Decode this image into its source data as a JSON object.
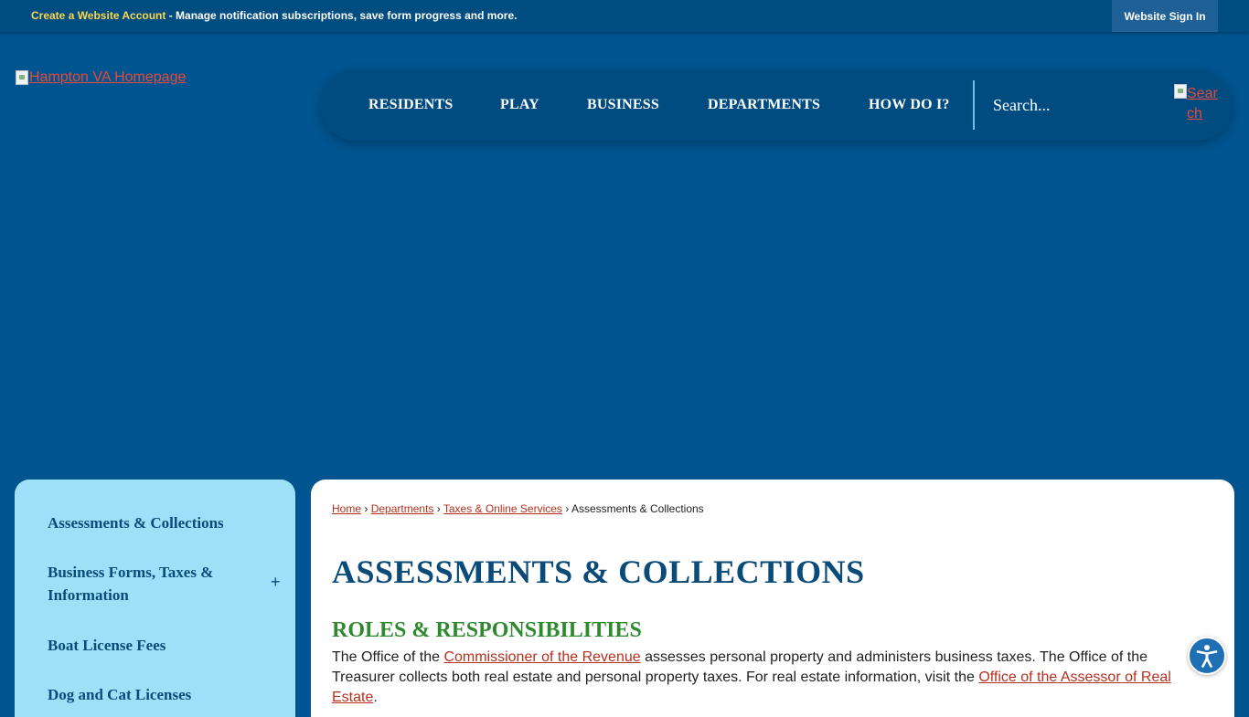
{
  "topbar": {
    "create_account_link": "Create a Website Account",
    "message": " - Manage notification subscriptions, save form progress and more.",
    "signin_label": "Website Sign In"
  },
  "logo": {
    "alt_text": "Hampton VA Homepage"
  },
  "nav": {
    "items": [
      {
        "label": "RESIDENTS"
      },
      {
        "label": "PLAY"
      },
      {
        "label": "BUSINESS"
      },
      {
        "label": "DEPARTMENTS"
      },
      {
        "label": "HOW DO I?"
      }
    ],
    "search_placeholder": "Search...",
    "search_button_alt": "Search"
  },
  "sidebar": {
    "items": [
      {
        "label": "Assessments & Collections"
      },
      {
        "label": "Business Forms, Taxes & Information",
        "expander": "+"
      },
      {
        "label": "Boat License Fees"
      },
      {
        "label": "Dog and Cat Licenses"
      }
    ]
  },
  "breadcrumb": {
    "links": [
      "Home",
      "Departments",
      "Taxes & Online Services"
    ],
    "separator": "›",
    "current": "Assessments & Collections"
  },
  "main": {
    "title": "ASSESSMENTS & COLLECTIONS",
    "section_title": "ROLES & RESPONSIBILITIES",
    "para_1": "The Office of the ",
    "para_link_1": "Commissioner of the Revenue",
    "para_2": " assesses personal property and administers business taxes. The Office of the Treasurer collects both real estate and personal property taxes. For real estate information, visit the ",
    "para_link_2": "Office of the Assessor of Real Estate",
    "para_3": "."
  },
  "colors": {
    "page_bg": "#00548f",
    "accent_yellow": "#ffd64a",
    "link_red": "#b5301f",
    "sidebar_bg": "#9ee0f8",
    "heading_blue": "#0b4b7a",
    "heading_green": "#2f8a2e"
  },
  "icons": {
    "accessibility": "accessibility-icon"
  }
}
